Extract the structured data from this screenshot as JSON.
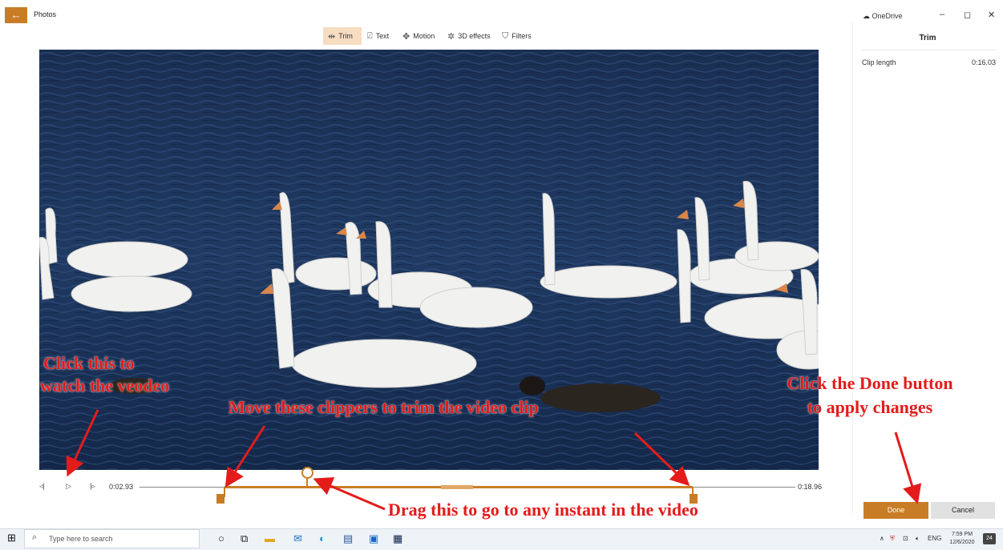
{
  "window": {
    "title": "Photos",
    "onedrive_label": "OneDrive",
    "controls": {
      "minimize": "–",
      "maximize": "◻",
      "close": "✕"
    }
  },
  "toolbar": {
    "items": [
      {
        "label": "Trim",
        "icon": "trim-icon",
        "active": true
      },
      {
        "label": "Text",
        "icon": "text-icon",
        "active": false
      },
      {
        "label": "Motion",
        "icon": "motion-icon",
        "active": false
      },
      {
        "label": "3D effects",
        "icon": "3d-effects-icon",
        "active": false
      },
      {
        "label": "Filters",
        "icon": "filters-icon",
        "active": false
      }
    ]
  },
  "panel": {
    "title": "Trim",
    "clip_length_label": "Clip length",
    "clip_length_value": "0:16.03",
    "done_label": "Done",
    "cancel_label": "Cancel"
  },
  "playback": {
    "current_time": "0:02.93",
    "end_time": "0:18.96",
    "trim_start_fraction": 0.13,
    "trim_end_fraction": 0.84,
    "playhead_fraction": 0.25
  },
  "annotations": {
    "watch": "Click this to\nwatch the veodeo",
    "clippers": "Move these clippers to trim the video clip",
    "done": "Click the Done button\nto apply changes",
    "drag": "Drag this to go to any instant in the video"
  },
  "taskbar": {
    "search_placeholder": "Type here to search",
    "language": "ENG",
    "time": "7:59 PM",
    "date": "12/6/2020",
    "notification_count": "24"
  },
  "colors": {
    "accent": "#c97c26",
    "annotation": "#e41b1b",
    "water": "#1d3558"
  }
}
